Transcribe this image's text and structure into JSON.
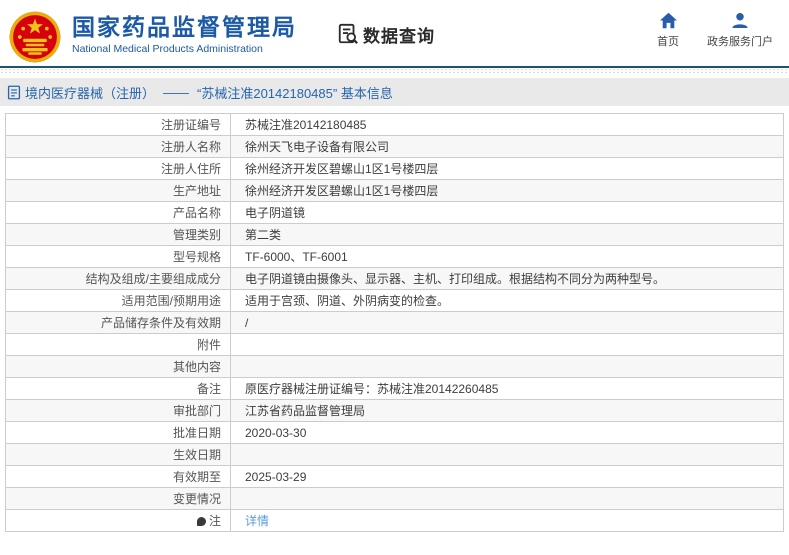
{
  "colors": {
    "accent_blue": "#1c5aa5",
    "nav_icon_blue": "#2a5caa",
    "breadcrumb_blue": "#2565ae",
    "link_blue": "#5a9bd8",
    "header_rule_blue": "#1b5376",
    "emblem_red": "#d7000f",
    "emblem_gold": "#f0c419",
    "bar_gray": "#e9e9e9",
    "alt_row_gray": "#f7f7f7",
    "border_gray": "#cccccc"
  },
  "header": {
    "org_title_zh": "国家药品监督管理局",
    "org_title_en": "National Medical Products Administration",
    "section_title": "数据查询",
    "nav": [
      {
        "icon": "home-icon",
        "label": "首页"
      },
      {
        "icon": "user-icon",
        "label": "政务服务门户"
      }
    ]
  },
  "breadcrumb": {
    "icon": "document-icon",
    "category": "境内医疗器械（注册）",
    "separator": "——",
    "current": "“苏械注准20142180485” 基本信息"
  },
  "table": {
    "rows": [
      {
        "label": "注册证编号",
        "value": "苏械注准20142180485"
      },
      {
        "label": "注册人名称",
        "value": "徐州天飞电子设备有限公司"
      },
      {
        "label": "注册人住所",
        "value": "徐州经济开发区碧螺山1区1号楼四层"
      },
      {
        "label": "生产地址",
        "value": "徐州经济开发区碧螺山1区1号楼四层"
      },
      {
        "label": "产品名称",
        "value": "电子阴道镜"
      },
      {
        "label": "管理类别",
        "value": "第二类"
      },
      {
        "label": "型号规格",
        "value": "TF-6000、TF-6001"
      },
      {
        "label": "结构及组成/主要组成成分",
        "value": "电子阴道镜由摄像头、显示器、主机、打印组成。根据结构不同分为两种型号。"
      },
      {
        "label": "适用范围/预期用途",
        "value": "适用于宫颈、阴道、外阴病变的检查。"
      },
      {
        "label": "产品储存条件及有效期",
        "value": "/"
      },
      {
        "label": "附件",
        "value": ""
      },
      {
        "label": "其他内容",
        "value": ""
      },
      {
        "label": "备注",
        "value": "原医疗器械注册证编号：苏械注准20142260485"
      },
      {
        "label": "审批部门",
        "value": "江苏省药品监督管理局"
      },
      {
        "label": "批准日期",
        "value": "2020-03-30"
      },
      {
        "label": "生效日期",
        "value": ""
      },
      {
        "label": "有效期至",
        "value": "2025-03-29"
      },
      {
        "label": "变更情况",
        "value": ""
      },
      {
        "label": "注",
        "value": "详情",
        "is_link": true,
        "icon": "note-icon"
      }
    ]
  }
}
